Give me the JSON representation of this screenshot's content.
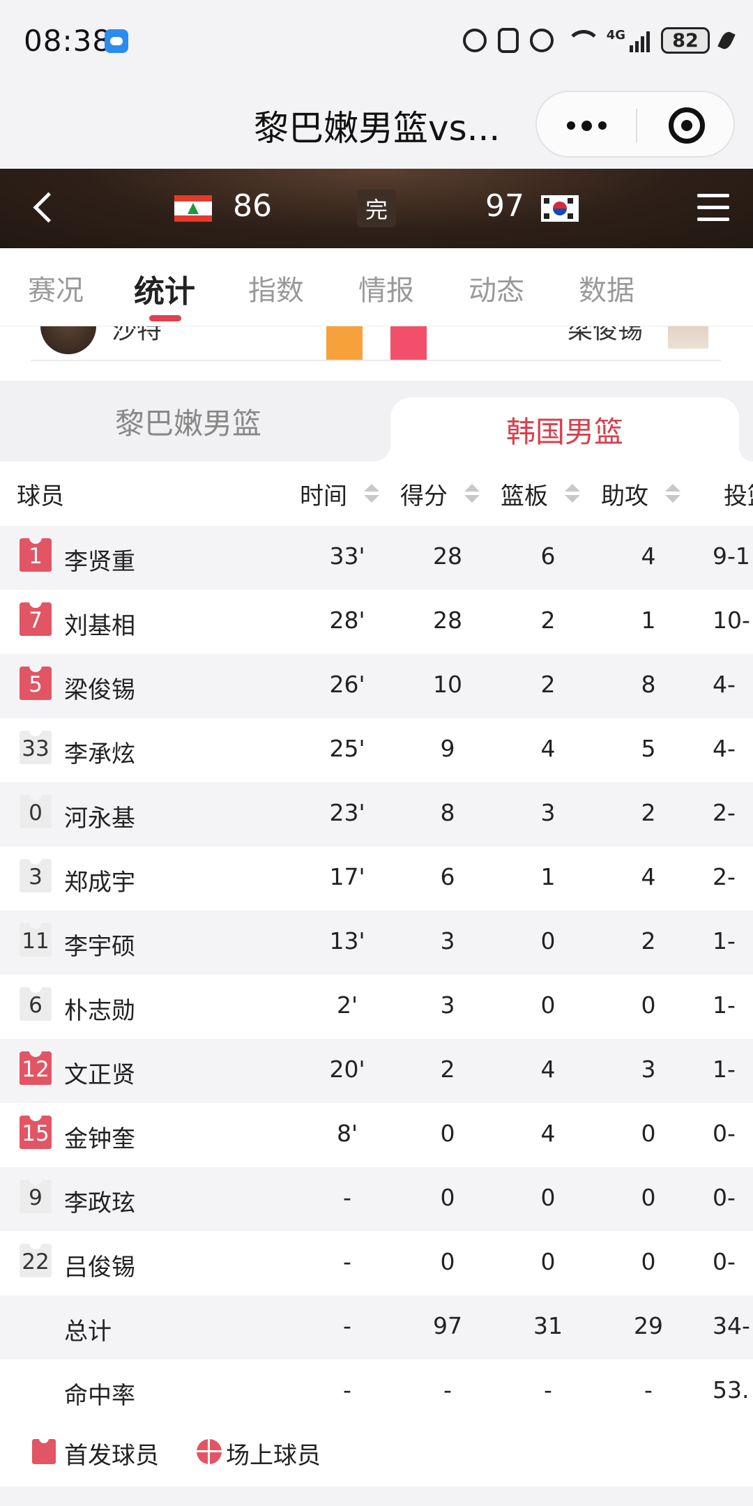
{
  "status_bar": {
    "time": "08:38",
    "network": "4G",
    "battery": "82",
    "icons": [
      "app-notification-icon",
      "hd-icon",
      "nfc-icon",
      "alarm-icon",
      "wifi-icon",
      "signal-icon",
      "battery-icon",
      "battery-saver-icon"
    ]
  },
  "title_bar": {
    "title": "黎巴嫩男篮vs...",
    "more_icon": "more-dots-icon",
    "close_icon": "close-target-icon"
  },
  "match": {
    "home_score": "86",
    "status": "完",
    "away_score": "97",
    "home_flag": "lebanon-flag-icon",
    "away_flag": "south-korea-flag-icon"
  },
  "tabs": [
    "赛况",
    "统计",
    "指数",
    "情报",
    "动态",
    "数据"
  ],
  "active_tab": "统计",
  "prev_section": {
    "left_name": "沙特",
    "right_name": "梁俊锡"
  },
  "team_switch": {
    "home": "黎巴嫩男篮",
    "away": "韩国男篮",
    "active": "韩国男篮"
  },
  "table": {
    "headers": {
      "player": "球员",
      "time": "时间",
      "points": "得分",
      "rebounds": "篮板",
      "assists": "助攻",
      "fg": "投篮"
    },
    "rows": [
      {
        "number": "1",
        "name": "李贤重",
        "time": "33'",
        "points": "28",
        "rebounds": "6",
        "assists": "4",
        "fg": "9-1",
        "starter": true
      },
      {
        "number": "7",
        "name": "刘基相",
        "time": "28'",
        "points": "28",
        "rebounds": "2",
        "assists": "1",
        "fg": "10-",
        "starter": true
      },
      {
        "number": "5",
        "name": "梁俊锡",
        "time": "26'",
        "points": "10",
        "rebounds": "2",
        "assists": "8",
        "fg": "4-",
        "starter": true
      },
      {
        "number": "33",
        "name": "李承炫",
        "time": "25'",
        "points": "9",
        "rebounds": "4",
        "assists": "5",
        "fg": "4-",
        "starter": false
      },
      {
        "number": "0",
        "name": "河永基",
        "time": "23'",
        "points": "8",
        "rebounds": "3",
        "assists": "2",
        "fg": "2-",
        "starter": false
      },
      {
        "number": "3",
        "name": "郑成宇",
        "time": "17'",
        "points": "6",
        "rebounds": "1",
        "assists": "4",
        "fg": "2-",
        "starter": false
      },
      {
        "number": "11",
        "name": "李宇硕",
        "time": "13'",
        "points": "3",
        "rebounds": "0",
        "assists": "2",
        "fg": "1-",
        "starter": false
      },
      {
        "number": "6",
        "name": "朴志勋",
        "time": "2'",
        "points": "3",
        "rebounds": "0",
        "assists": "0",
        "fg": "1-",
        "starter": false
      },
      {
        "number": "12",
        "name": "文正贤",
        "time": "20'",
        "points": "2",
        "rebounds": "4",
        "assists": "3",
        "fg": "1-",
        "starter": true
      },
      {
        "number": "15",
        "name": "金钟奎",
        "time": "8'",
        "points": "0",
        "rebounds": "4",
        "assists": "0",
        "fg": "0-",
        "starter": true
      },
      {
        "number": "9",
        "name": "李政玹",
        "time": "-",
        "points": "0",
        "rebounds": "0",
        "assists": "0",
        "fg": "0-",
        "starter": false
      },
      {
        "number": "22",
        "name": "吕俊锡",
        "time": "-",
        "points": "0",
        "rebounds": "0",
        "assists": "0",
        "fg": "0-",
        "starter": false
      }
    ],
    "summary": [
      {
        "label": "总计",
        "time": "-",
        "points": "97",
        "rebounds": "31",
        "assists": "29",
        "fg": "34-"
      },
      {
        "label": "命中率",
        "time": "-",
        "points": "-",
        "rebounds": "-",
        "assists": "-",
        "fg": "53."
      }
    ]
  },
  "legend": {
    "starter": "首发球员",
    "on_court": "场上球员"
  },
  "colors": {
    "accent": "#e0404f",
    "starter_jersey": "#e25564",
    "header_bg": "#2e2018"
  }
}
